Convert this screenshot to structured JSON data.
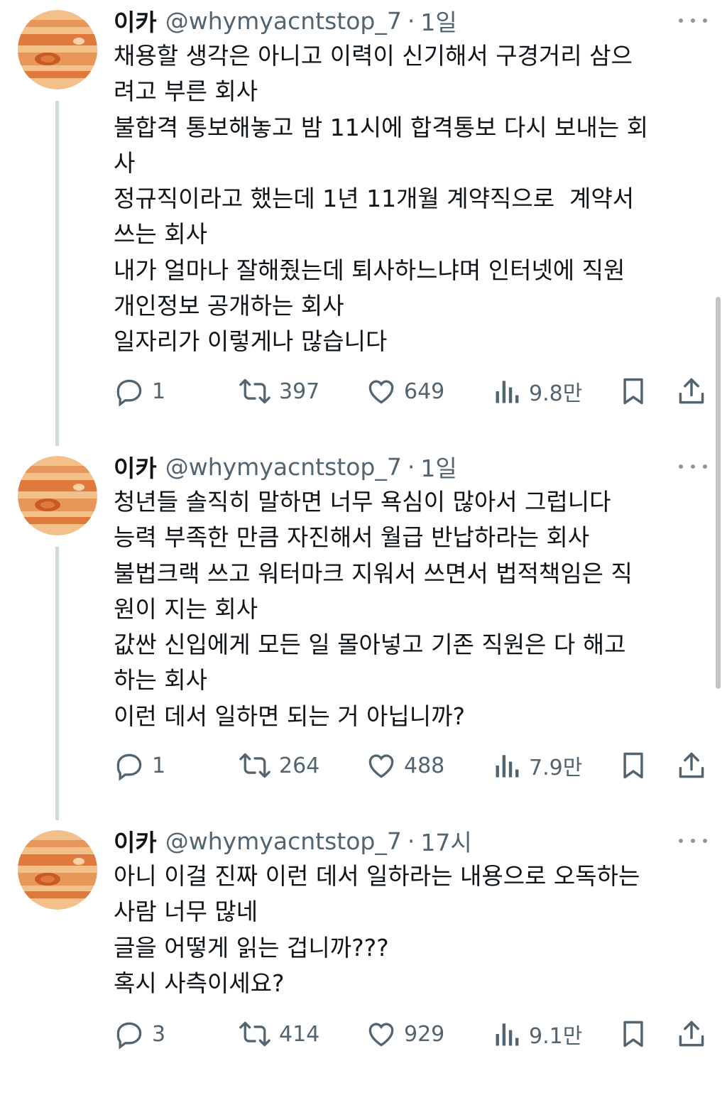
{
  "tweets": [
    {
      "name": "이카",
      "handle": "@whymyacntstop_7",
      "separator": "·",
      "time": "1일",
      "lines": [
        "채용할 생각은 아니고 이력이 신기해서 구경거리 삼으",
        "려고 부른 회사",
        "불합격 통보해놓고 밤 11시에 합격통보 다시 보내는 회",
        "사",
        "정규직이라고 했는데 1년 11개월 계약직으로  계약서",
        "쓰는 회사",
        "내가 얼마나 잘해줬는데 퇴사하느냐며 인터넷에 직원",
        "개인정보 공개하는 회사",
        "일자리가 이렇게나 많습니다"
      ],
      "replies": "1",
      "retweets": "397",
      "likes": "649",
      "views": "9.8만"
    },
    {
      "name": "이카",
      "handle": "@whymyacntstop_7",
      "separator": "·",
      "time": "1일",
      "lines": [
        "청년들 솔직히 말하면 너무 욕심이 많아서 그럽니다",
        "능력 부족한 만큼 자진해서 월급 반납하라는 회사",
        "불법크랙 쓰고 워터마크 지워서 쓰면서 법적책임은 직",
        "원이 지는 회사",
        "값싼 신입에게 모든 일 몰아넣고 기존 직원은 다 해고",
        "하는 회사",
        "이런 데서 일하면 되는 거 아닙니까?"
      ],
      "replies": "1",
      "retweets": "264",
      "likes": "488",
      "views": "7.9만"
    },
    {
      "name": "이카",
      "handle": "@whymyacntstop_7",
      "separator": "·",
      "time": "17시",
      "lines": [
        "아니 이걸 진짜 이런 데서 일하라는 내용으로 오독하는",
        "사람 너무 많네",
        "글을 어떻게 읽는 겁니까???",
        "혹시 사측이세요?"
      ],
      "replies": "3",
      "retweets": "414",
      "likes": "929",
      "views": "9.1만"
    }
  ],
  "icons": {
    "reply": "reply-icon",
    "retweet": "retweet-icon",
    "like": "heart-icon",
    "views": "views-icon",
    "bookmark": "bookmark-icon",
    "share": "share-icon",
    "more": "more-icon",
    "avatar": "jupiter-avatar"
  },
  "colors": {
    "text": "#0f1419",
    "secondary": "#536471",
    "thread_line": "#cfd9de",
    "avatar_orange": "#e8975a"
  }
}
